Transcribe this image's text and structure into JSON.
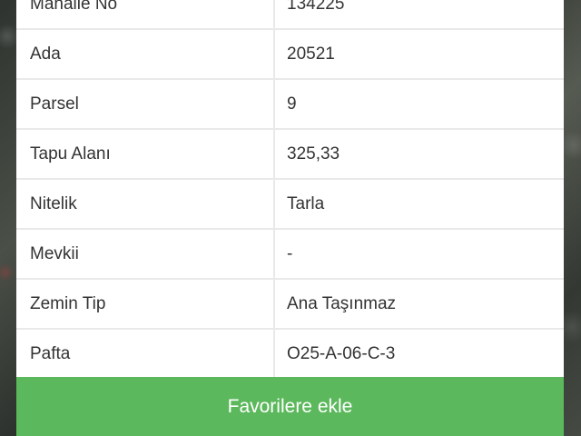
{
  "details": {
    "rows": [
      {
        "label": "Mahalle No",
        "value": "134225"
      },
      {
        "label": "Ada",
        "value": "20521"
      },
      {
        "label": "Parsel",
        "value": "9"
      },
      {
        "label": "Tapu Alanı",
        "value": "325,33"
      },
      {
        "label": "Nitelik",
        "value": "Tarla"
      },
      {
        "label": "Mevkii",
        "value": "-"
      },
      {
        "label": "Zemin Tip",
        "value": "Ana Taşınmaz"
      },
      {
        "label": "Pafta",
        "value": "O25-A-06-C-3"
      }
    ]
  },
  "actions": {
    "favorite_label": "Favorilere ekle",
    "favorite_color": "#5cb85c"
  }
}
